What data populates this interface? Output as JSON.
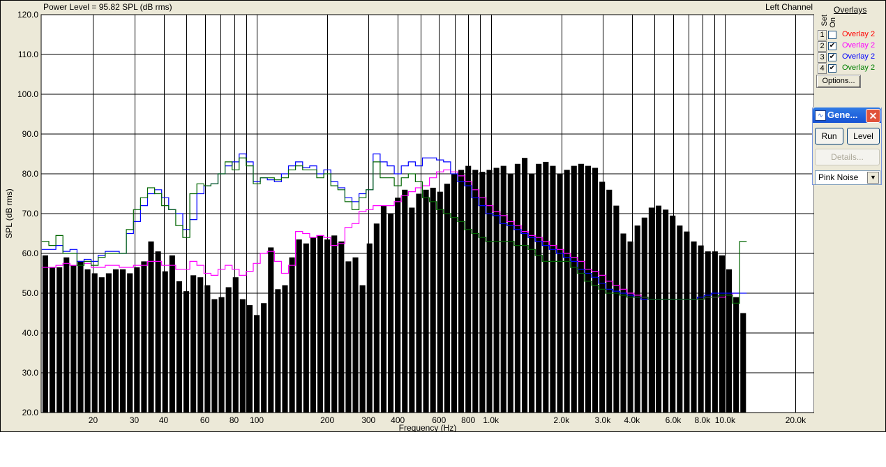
{
  "header": {
    "power_level": "Power Level = 95.82 SPL (dB rms)",
    "channel": "Left Channel"
  },
  "overlays": {
    "title": "Overlays",
    "col_set": "Set",
    "col_on": "On",
    "items": [
      {
        "num": "1",
        "checked": false,
        "label": "Overlay 2",
        "color": "#ff0000"
      },
      {
        "num": "2",
        "checked": true,
        "label": "Overlay 2",
        "color": "#ff00ff"
      },
      {
        "num": "3",
        "checked": true,
        "label": "Overlay 2",
        "color": "#0000ff"
      },
      {
        "num": "4",
        "checked": true,
        "label": "Overlay 2",
        "color": "#008000"
      }
    ],
    "options_label": "Options..."
  },
  "generator": {
    "title": "Gene...",
    "run_label": "Run",
    "level_label": "Level",
    "details_label": "Details...",
    "signal": "Pink Noise"
  },
  "chart_data": {
    "type": "bar",
    "xlabel": "Frequency (Hz)",
    "ylabel": "SPL (dB rms)",
    "xscale": "log",
    "xlim": [
      12,
      24000
    ],
    "ylim": [
      20,
      120
    ],
    "grid": true,
    "yticks": [
      "20.0",
      "30.0",
      "40.0",
      "50.0",
      "60.0",
      "70.0",
      "80.0",
      "90.0",
      "100.0",
      "110.0",
      "120.0"
    ],
    "xticks": [
      {
        "v": 20,
        "label": "20"
      },
      {
        "v": 30,
        "label": "30"
      },
      {
        "v": 40,
        "label": "40"
      },
      {
        "v": 60,
        "label": "60"
      },
      {
        "v": 80,
        "label": "80"
      },
      {
        "v": 100,
        "label": "100"
      },
      {
        "v": 200,
        "label": "200"
      },
      {
        "v": 300,
        "label": "300"
      },
      {
        "v": 400,
        "label": "400"
      },
      {
        "v": 600,
        "label": "600"
      },
      {
        "v": 800,
        "label": "800"
      },
      {
        "v": 1000,
        "label": "1.0k"
      },
      {
        "v": 2000,
        "label": "2.0k"
      },
      {
        "v": 3000,
        "label": "3.0k"
      },
      {
        "v": 4000,
        "label": "4.0k"
      },
      {
        "v": 6000,
        "label": "6.0k"
      },
      {
        "v": 8000,
        "label": "8.0k"
      },
      {
        "v": 10000,
        "label": "10.0k"
      },
      {
        "v": 20000,
        "label": "20.0k"
      }
    ],
    "bars": [
      59.5,
      56.5,
      56.5,
      59.0,
      57.0,
      58.0,
      56.0,
      55.0,
      54.0,
      55.0,
      56.0,
      56.0,
      55.0,
      56.5,
      58.0,
      63.0,
      60.5,
      55.5,
      59.5,
      53.0,
      50.5,
      54.5,
      54.0,
      52.0,
      48.5,
      49.0,
      51.5,
      54.0,
      48.5,
      47.0,
      44.5,
      47.5,
      61.5,
      51.0,
      52.0,
      59.0,
      63.5,
      62.5,
      64.0,
      64.5,
      63.5,
      64.5,
      63.0,
      58.0,
      59.0,
      52.0,
      62.5,
      67.5,
      72.0,
      70.0,
      74.0,
      76.0,
      71.5,
      75.0,
      76.0,
      76.5,
      75.5,
      77.5,
      80.0,
      81.0,
      82.0,
      81.0,
      80.5,
      81.0,
      81.5,
      82.0,
      80.0,
      82.5,
      84.0,
      80.0,
      82.5,
      83.0,
      82.0,
      80.0,
      81.0,
      82.0,
      82.5,
      82.0,
      81.5,
      78.0,
      76.0,
      72.0,
      65.0,
      63.0,
      67.0,
      69.0,
      71.5,
      72.0,
      71.0,
      69.5,
      67.0,
      65.5,
      63.0,
      62.0,
      60.5,
      60.5,
      59.5,
      56.0,
      49.0,
      45.0
    ],
    "series": [
      {
        "name": "Overlay 2",
        "color": "#ff00ff",
        "values": [
          56.5,
          56.5,
          57,
          57.5,
          57,
          58,
          57.5,
          56.5,
          56.5,
          57,
          57,
          56.5,
          56.5,
          57,
          57,
          58,
          58,
          57,
          57,
          56,
          56,
          58,
          57,
          55,
          54.5,
          56,
          57,
          56,
          54.5,
          55.5,
          57.5,
          60,
          60.5,
          58,
          55,
          57,
          65.5,
          65,
          64,
          64.5,
          64,
          62,
          62.5,
          66.5,
          67.5,
          70.5,
          71,
          72,
          72,
          72,
          73,
          74.5,
          75.5,
          76.5,
          77,
          79,
          80.5,
          81,
          80.5,
          79.5,
          78,
          76,
          74,
          72,
          70.5,
          69.5,
          68,
          67,
          65.5,
          64.5,
          64,
          63,
          62,
          61,
          60,
          59,
          58,
          56,
          55.5,
          54.5,
          53,
          52,
          51,
          50,
          49.5,
          49,
          48.5,
          48.5,
          48.5,
          48.5,
          48.5,
          48.5,
          48.5,
          48.5,
          49,
          49,
          49,
          49.5,
          50
        ]
      },
      {
        "name": "Overlay 2",
        "color": "#0000ff",
        "values": [
          61,
          61,
          62,
          60.5,
          61,
          58,
          58.5,
          58,
          59.5,
          60.5,
          60.5,
          60,
          65,
          68,
          72,
          75,
          76,
          74,
          71,
          70,
          66,
          68.5,
          75,
          77,
          77.5,
          80,
          82,
          83,
          85,
          83,
          78,
          79,
          78.5,
          78,
          80,
          82,
          83,
          81.5,
          82,
          80,
          81,
          78,
          76.5,
          74,
          73,
          75,
          76,
          85,
          83,
          82,
          80,
          82,
          83,
          82,
          84,
          84,
          83.5,
          83,
          80,
          78,
          77,
          74,
          72,
          70,
          69.5,
          67.5,
          67,
          66,
          65,
          64,
          63,
          62,
          61,
          60,
          59,
          58,
          56,
          55,
          54,
          52.5,
          51,
          50.5,
          50,
          49.5,
          49,
          48.5,
          48.5,
          48.5,
          48.5,
          48.5,
          48.5,
          48.5,
          48.5,
          49,
          49.5,
          50,
          50,
          50,
          50,
          50
        ]
      },
      {
        "name": "Overlay 2",
        "color": "#006600",
        "values": [
          63,
          62,
          64.5,
          60,
          60,
          57,
          58,
          57,
          59,
          60,
          60,
          60,
          66,
          71,
          74,
          76.5,
          75,
          72,
          71,
          67,
          64,
          75,
          77.5,
          77,
          77.5,
          80,
          83,
          81,
          84,
          82,
          77.5,
          79,
          79,
          78.5,
          79,
          81,
          82,
          81,
          81,
          79,
          80,
          77,
          76,
          73,
          71,
          74,
          76,
          83,
          79,
          79,
          77,
          79,
          80,
          78,
          74,
          73,
          71,
          70,
          69,
          68,
          66,
          65,
          64,
          63,
          63,
          63,
          63,
          62,
          62,
          61,
          59.5,
          58,
          58,
          58,
          58,
          56.5,
          55,
          53,
          52,
          51,
          50,
          50,
          49.5,
          49,
          49,
          49,
          48.5,
          48.5,
          48.5,
          48.5,
          48.5,
          48.5,
          48.5,
          48.5,
          49,
          49,
          49.5,
          49.5,
          47.5,
          63
        ]
      }
    ]
  }
}
